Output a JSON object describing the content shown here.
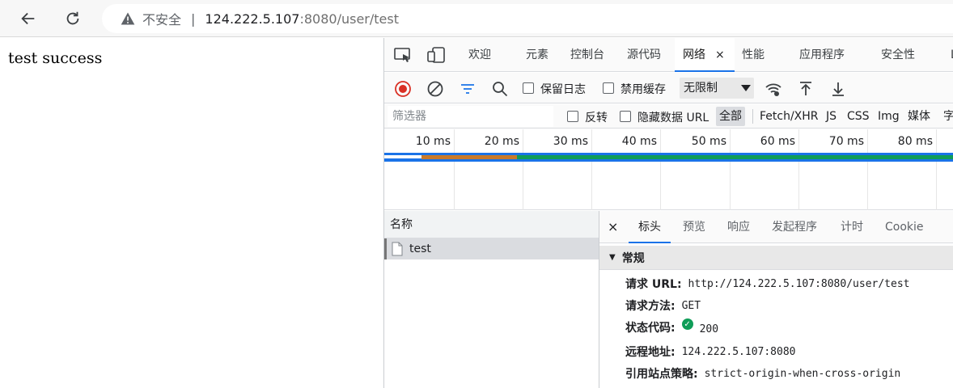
{
  "browser": {
    "address": {
      "insecure_label": "不安全",
      "separator": "|",
      "host": "124.222.5.107",
      "rest": ":8080/user/test"
    }
  },
  "page": {
    "body_text": "test success"
  },
  "devtools": {
    "tabs": [
      "欢迎",
      "元素",
      "控制台",
      "源代码",
      "网络",
      "性能",
      "应用程序",
      "安全性",
      "L"
    ],
    "active_tab_close": "×",
    "network_toolbar": {
      "preserve_log": "保留日志",
      "disable_cache": "禁用缓存",
      "throttle": "无限制"
    },
    "filter_bar": {
      "placeholder": "筛选器",
      "invert": "反转",
      "hide_data_urls": "隐藏数据 URL",
      "types": [
        "全部",
        "Fetch/XHR",
        "JS",
        "CSS",
        "Img",
        "媒体",
        "字"
      ]
    },
    "timeline": {
      "ticks": [
        "10 ms",
        "20 ms",
        "30 ms",
        "40 ms",
        "50 ms",
        "60 ms",
        "70 ms",
        "80 ms"
      ]
    },
    "names_panel": {
      "header": "名称",
      "rows": [
        "test"
      ]
    },
    "detail": {
      "close": "×",
      "tabs": [
        "标头",
        "预览",
        "响应",
        "发起程序",
        "计时",
        "Cookie"
      ],
      "section_title": "常规",
      "general": [
        {
          "key": "请求 URL:",
          "value": "http://124.222.5.107:8080/user/test"
        },
        {
          "key": "请求方法:",
          "value": "GET"
        },
        {
          "key": "状态代码:",
          "value": "200"
        },
        {
          "key": "远程地址:",
          "value": "124.222.5.107:8080"
        },
        {
          "key": "引用站点策略:",
          "value": "strict-origin-when-cross-origin"
        }
      ]
    }
  },
  "colors": {
    "accent": "#1a73e8",
    "record_red": "#d93025",
    "status_green": "#0f9d58",
    "waterfall_orange": "#c97a2b"
  }
}
